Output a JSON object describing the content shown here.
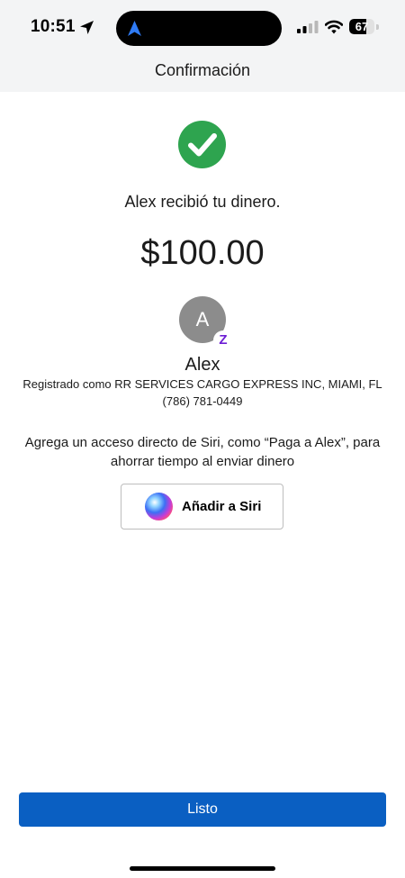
{
  "status_bar": {
    "time": "10:51",
    "battery_level": "67",
    "battery_fraction": 0.67,
    "icons": [
      "location-arrow-icon",
      "cellular-signal-icon",
      "wifi-icon",
      "battery-icon"
    ]
  },
  "header": {
    "title": "Confirmación"
  },
  "confirmation": {
    "icon": "checkmark-icon",
    "message": "Alex recibió tu dinero.",
    "amount": "$100.00"
  },
  "recipient": {
    "avatar_initial": "A",
    "badge": "Z",
    "name": "Alex",
    "registered_as": "Registrado como RR SERVICES CARGO EXPRESS INC, MIAMI, FL",
    "phone": "(786) 781-0449"
  },
  "siri": {
    "prompt": "Agrega un acceso directo de Siri, como “Paga a Alex”, para ahorrar tiempo al enviar dinero",
    "button_label": "Añadir a Siri"
  },
  "footer": {
    "done_label": "Listo"
  },
  "colors": {
    "success": "#2ea44f",
    "primary": "#0a5fc2",
    "zelle": "#6d1ed4",
    "avatar": "#8c8c8c",
    "header_bg": "#f3f4f5"
  }
}
